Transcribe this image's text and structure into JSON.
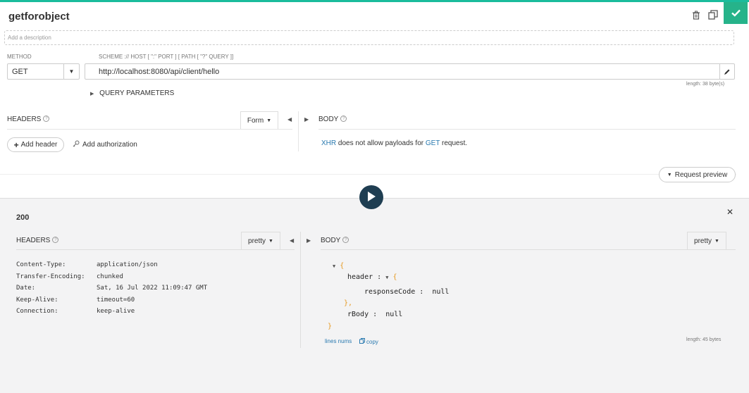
{
  "request": {
    "title": "getforobject",
    "description_placeholder": "Add a description",
    "method_label": "METHOD",
    "method_value": "GET",
    "url_label": "SCHEME :// HOST [ \":\" PORT ] [ PATH [ \"?\" QUERY ]]",
    "url_value": "http://localhost:8080/api/client/hello",
    "url_length": "length: 38 byte(s)",
    "query_params_label": "QUERY PARAMETERS",
    "headers_label": "HEADERS",
    "form_label": "Form",
    "add_header_label": "Add header",
    "add_authorization_label": "Add authorization",
    "body_label": "BODY",
    "body_message": {
      "xhr": "XHR",
      "middle": " does not allow payloads for ",
      "method": "GET",
      "end": " request."
    },
    "request_preview_label": "Request preview"
  },
  "response": {
    "status": "200",
    "headers_label": "HEADERS",
    "pretty_label": "pretty",
    "body_label": "BODY",
    "headers": [
      {
        "name": "Content-Type:",
        "value": "application/json"
      },
      {
        "name": "Transfer-Encoding:",
        "value": "chunked"
      },
      {
        "name": "Date:",
        "value": "Sat, 16 Jul 2022 11:09:47 GMT"
      },
      {
        "name": "Keep-Alive:",
        "value": "timeout=60"
      },
      {
        "name": "Connection:",
        "value": "keep-alive"
      }
    ],
    "json": {
      "open": "{",
      "header_key": "header :",
      "header_open": "{",
      "response_code_key": "responseCode :",
      "response_code_value": "null",
      "header_close": "},",
      "rbody_key": "rBody :",
      "rbody_value": "null",
      "close": "}"
    },
    "lines_nums_label": "lines nums",
    "copy_label": "copy",
    "body_length": "length: 45 bytes"
  },
  "colors": {
    "accent": "#1abc9c",
    "check_button": "#26b38a",
    "play_button": "#1f3e52",
    "link": "#2a7ab0",
    "json_brace": "#e69a22"
  },
  "icons": [
    "trash-icon",
    "duplicate-icon",
    "check-icon",
    "pencil-icon",
    "play-icon",
    "close-icon",
    "key-icon",
    "plus-icon",
    "copy-icon"
  ]
}
